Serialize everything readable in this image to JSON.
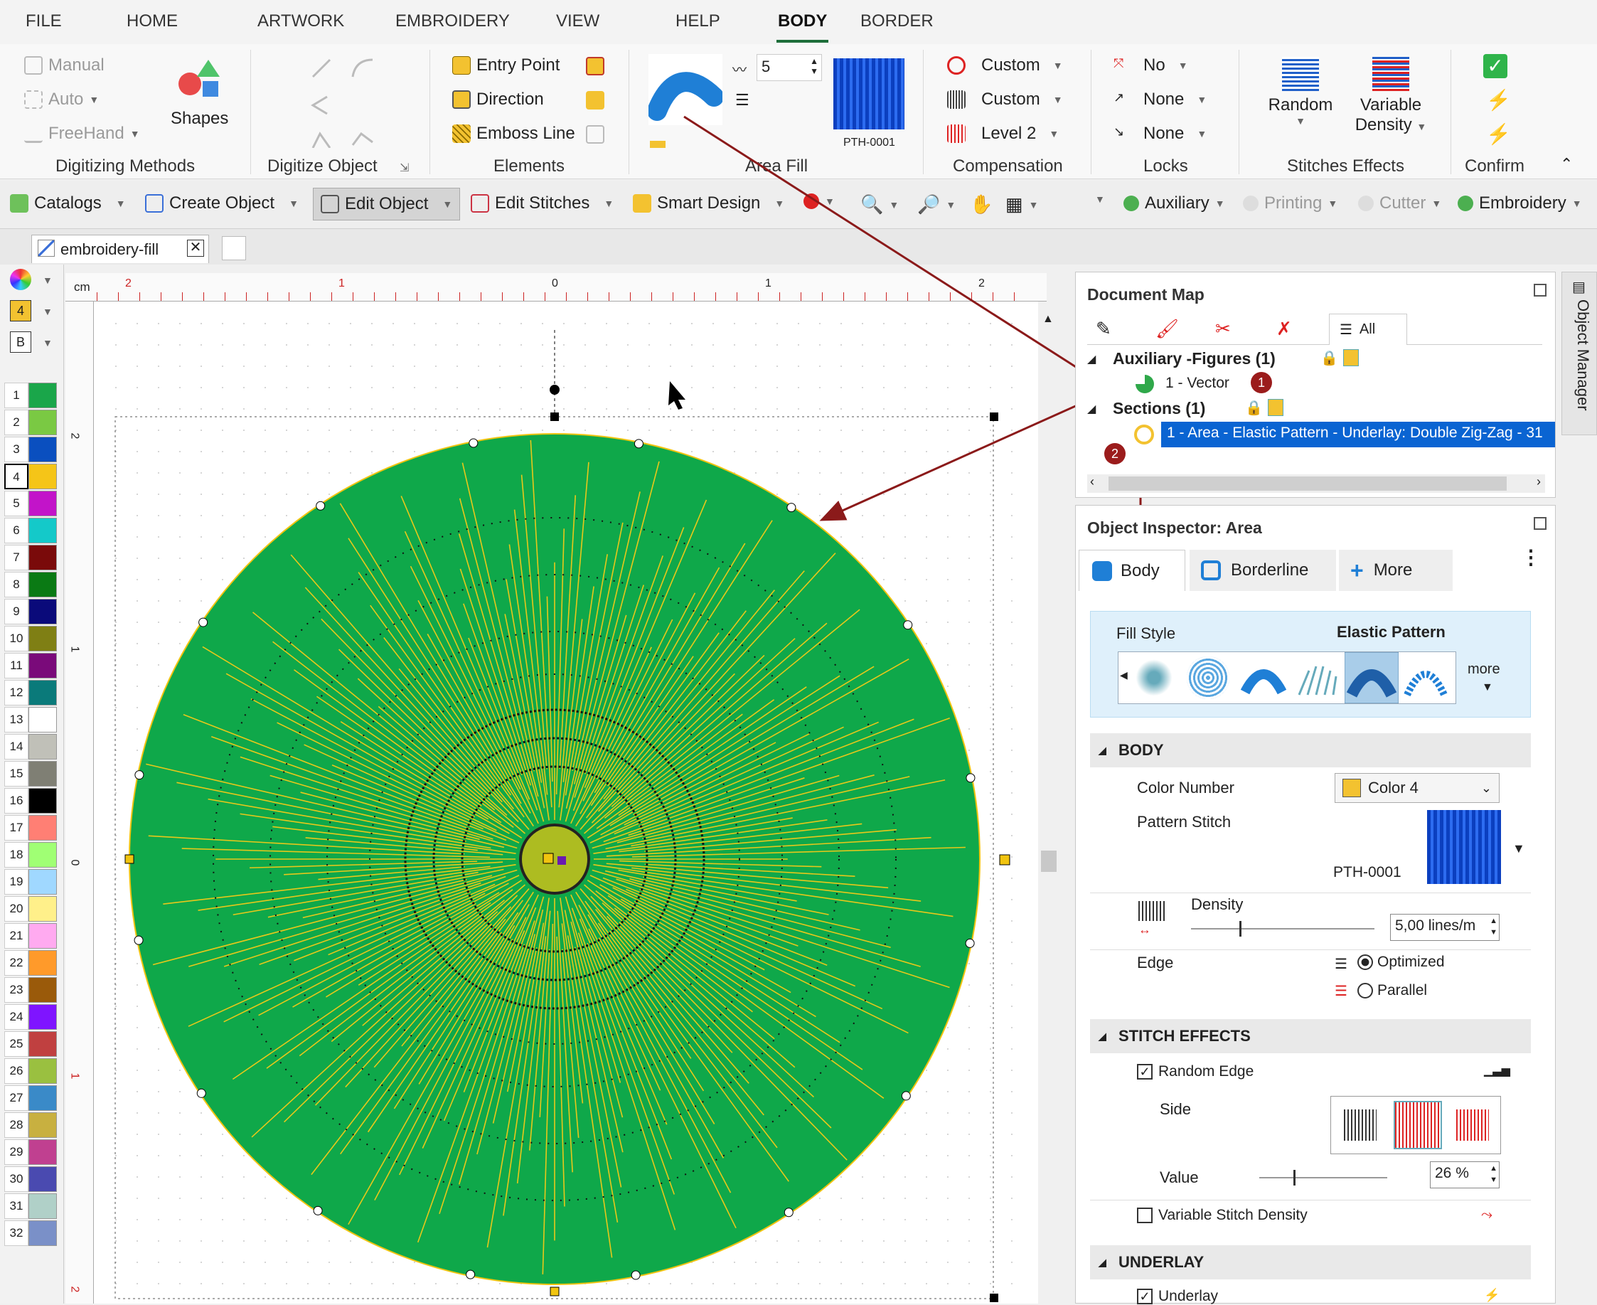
{
  "ribbon_tabs": [
    "FILE",
    "HOME",
    "ARTWORK",
    "EMBROIDERY",
    "VIEW",
    "HELP",
    "BODY",
    "BORDER"
  ],
  "ribbon": {
    "digitizing": {
      "manual": "Manual",
      "auto": "Auto",
      "freehand": "FreeHand",
      "shapes": "Shapes",
      "label": "Digitizing Methods"
    },
    "digitize_object": {
      "label": "Digitize Object"
    },
    "elements": {
      "entry": "Entry Point",
      "direction": "Direction",
      "emboss": "Emboss Line",
      "label": "Elements"
    },
    "area_fill": {
      "value": "5",
      "pattern": "PTH-0001",
      "label": "Area Fill"
    },
    "compensation": {
      "c1": "Custom",
      "c2": "Custom",
      "c3": "Level 2",
      "label": "Compensation"
    },
    "locks": {
      "l1": "No",
      "l2": "None",
      "l3": "None",
      "label": "Locks"
    },
    "stitch_effects": {
      "random": "Random",
      "variable": "Variable",
      "density": "Density",
      "label": "Stitches Effects"
    },
    "confirm": {
      "label": "Confirm"
    }
  },
  "toolbar": {
    "catalogs": "Catalogs",
    "create": "Create Object",
    "edit": "Edit Object",
    "stitches": "Edit Stitches",
    "smart": "Smart Design",
    "auxiliary": "Auxiliary",
    "printing": "Printing",
    "cutter": "Cutter",
    "embroidery": "Embroidery"
  },
  "doc_tab": "embroidery-fill",
  "palette": {
    "top_num": "4",
    "top_letter": "B",
    "rows": [
      {
        "n": "1",
        "c": "#1aa64a"
      },
      {
        "n": "2",
        "c": "#7ac943"
      },
      {
        "n": "3",
        "c": "#0a4fbf"
      },
      {
        "n": "4",
        "c": "#f5c518"
      },
      {
        "n": "5",
        "c": "#c214c9"
      },
      {
        "n": "6",
        "c": "#14c9c9"
      },
      {
        "n": "7",
        "c": "#7a0a0a"
      },
      {
        "n": "8",
        "c": "#0a7a14"
      },
      {
        "n": "9",
        "c": "#0a0a7a"
      },
      {
        "n": "10",
        "c": "#7f7f14"
      },
      {
        "n": "11",
        "c": "#7a0a7a"
      },
      {
        "n": "12",
        "c": "#0a7a7a"
      },
      {
        "n": "13",
        "c": "#ffffff"
      },
      {
        "n": "14",
        "c": "#c0c0b8"
      },
      {
        "n": "15",
        "c": "#7f7f74"
      },
      {
        "n": "16",
        "c": "#000000"
      },
      {
        "n": "17",
        "c": "#ff7f74"
      },
      {
        "n": "18",
        "c": "#a0ff74"
      },
      {
        "n": "19",
        "c": "#a0d8ff"
      },
      {
        "n": "20",
        "c": "#fff08a"
      },
      {
        "n": "21",
        "c": "#ffaaf0"
      },
      {
        "n": "22",
        "c": "#ff9a2a"
      },
      {
        "n": "23",
        "c": "#9a5a0a"
      },
      {
        "n": "24",
        "c": "#7f14ff"
      },
      {
        "n": "25",
        "c": "#c04040"
      },
      {
        "n": "26",
        "c": "#9ac040"
      },
      {
        "n": "27",
        "c": "#3a8ac8"
      },
      {
        "n": "28",
        "c": "#c8b040"
      },
      {
        "n": "29",
        "c": "#c04090"
      },
      {
        "n": "30",
        "c": "#4a4ab0"
      },
      {
        "n": "31",
        "c": "#b0d0c8"
      },
      {
        "n": "32",
        "c": "#7a90c8"
      }
    ]
  },
  "ruler": {
    "unit": "cm",
    "top": [
      "2",
      "1",
      "0",
      "1",
      "2"
    ],
    "left": [
      "2",
      "1",
      "0",
      "1",
      "2"
    ]
  },
  "doc_map": {
    "title": "Document Map",
    "all": "All",
    "aux": "Auxiliary -Figures (1)",
    "vector": "1 - Vector",
    "sections": "Sections (1)",
    "area": "1 - Area - Elastic Pattern - Underlay: Double Zig-Zag - 31",
    "badge1": "1",
    "badge2": "2"
  },
  "inspector": {
    "title": "Object Inspector: Area",
    "tabs": [
      "Body",
      "Borderline",
      "More"
    ],
    "fill_style_label": "Fill Style",
    "fill_style_value": "Elastic Pattern",
    "more": "more",
    "body_head": "BODY",
    "color_number": "Color Number",
    "color_value": "Color 4",
    "pattern_stitch": "Pattern Stitch",
    "pattern_code": "PTH-0001",
    "density": "Density",
    "density_value": "5,00 lines/m",
    "edge": "Edge",
    "optimized": "Optimized",
    "parallel": "Parallel",
    "effects_head": "STITCH EFFECTS",
    "random_edge": "Random Edge",
    "side": "Side",
    "value": "Value",
    "value_pct": "26 %",
    "variable_density": "Variable Stitch Density",
    "underlay_head": "UNDERLAY",
    "underlay": "Underlay"
  },
  "object_manager": "Object Manager",
  "colors": {
    "accent": "#1e6e3a",
    "fill_green": "#0fa84a",
    "thread": "#f1c40f",
    "selection": "#0a64d2",
    "arrow": "#8b1a1a"
  }
}
